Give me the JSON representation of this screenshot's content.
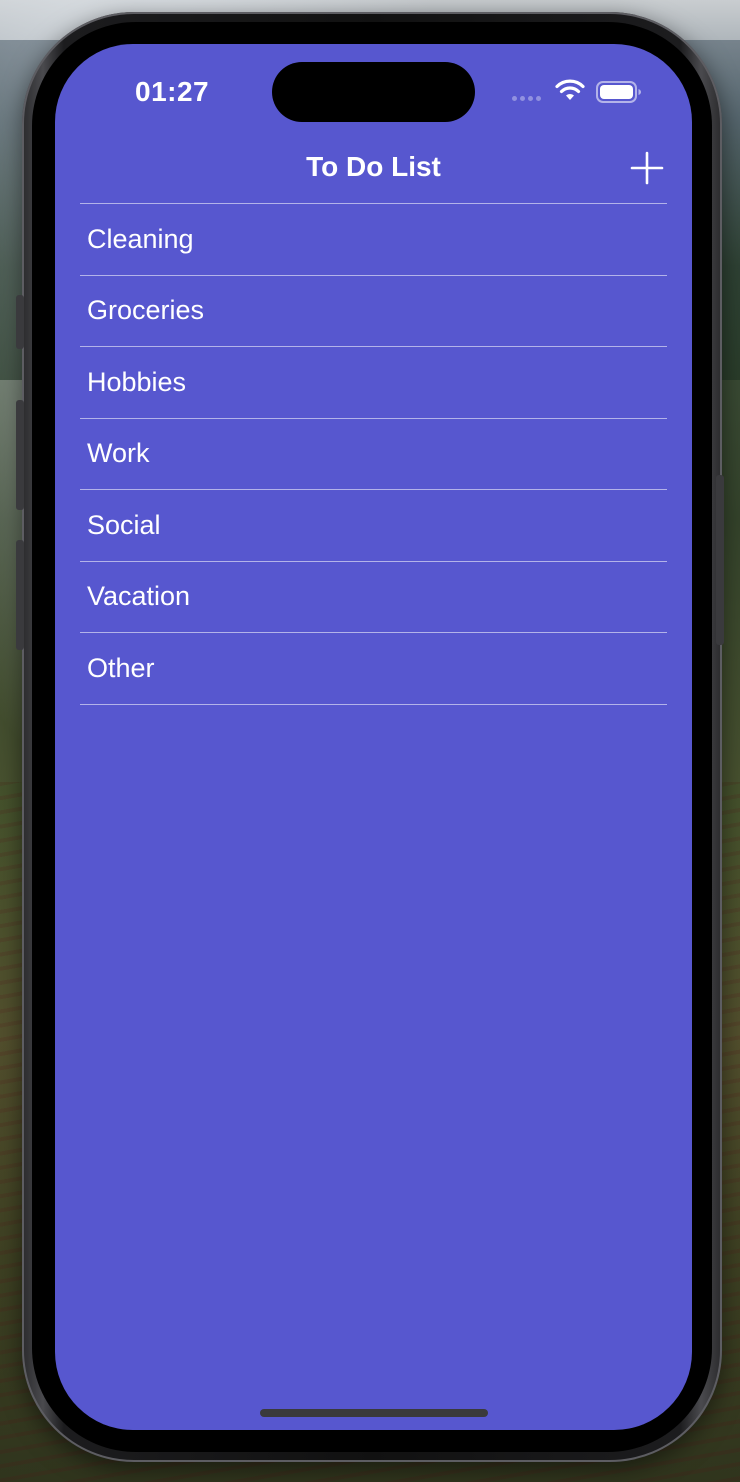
{
  "status_bar": {
    "time": "01:27",
    "icons": [
      "cellular-signal-icon",
      "wifi-icon",
      "battery-icon"
    ]
  },
  "nav": {
    "title": "To Do List",
    "add_icon": "plus-icon"
  },
  "list": {
    "items": [
      {
        "label": "Cleaning"
      },
      {
        "label": "Groceries"
      },
      {
        "label": "Hobbies"
      },
      {
        "label": "Work"
      },
      {
        "label": "Social"
      },
      {
        "label": "Vacation"
      },
      {
        "label": "Other"
      }
    ]
  },
  "colors": {
    "screen_background": "#5757cf",
    "text": "#ffffff",
    "separator": "rgba(255,255,255,0.55)"
  }
}
